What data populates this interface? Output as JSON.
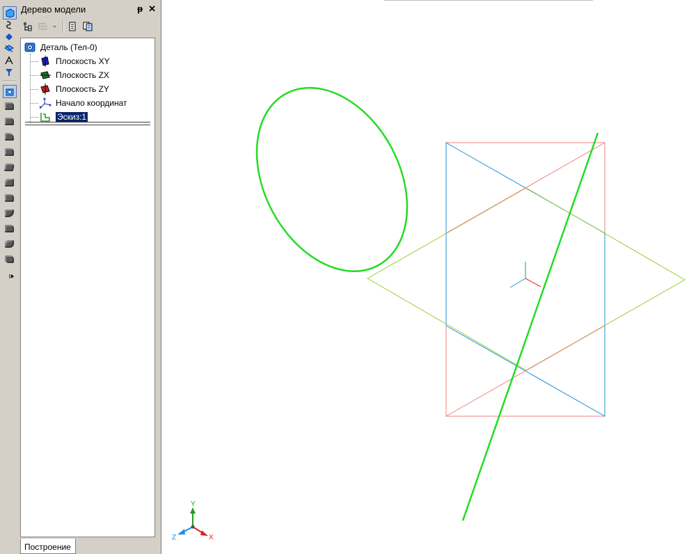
{
  "panel": {
    "title": "Дерево модели",
    "pin_glyph": "ᵽ",
    "close_glyph": "✕"
  },
  "tree": {
    "root": {
      "label": "Деталь (Тел-0)",
      "icon": "part-icon"
    },
    "items": [
      {
        "label": "Плоскость XY",
        "icon": "plane-xy-icon",
        "color": "#1c1cc8"
      },
      {
        "label": "Плоскость ZX",
        "icon": "plane-zx-icon",
        "color": "#1f7a1f"
      },
      {
        "label": "Плоскость ZY",
        "icon": "plane-zy-icon",
        "color": "#c82020"
      },
      {
        "label": "Начало координат",
        "icon": "origin-icon",
        "color": "#1c1cc8"
      },
      {
        "label": "Эскиз:1",
        "icon": "sketch-icon",
        "selected": true,
        "color": "#1f9a1f"
      }
    ]
  },
  "tabs": [
    {
      "label": "Построение",
      "active": true
    }
  ],
  "triad": {
    "x_label": "X",
    "y_label": "Y",
    "z_label": "Z",
    "x_color": "#e02020",
    "y_color": "#20a020",
    "z_color": "#2090e0"
  },
  "colors": {
    "sketch": "#22dd22",
    "plane_xy": "#1e90d8",
    "plane_zx": "#9acd32",
    "plane_zy": "#f08080",
    "selection": "#0a246a",
    "chrome": "#d4d0c8"
  }
}
